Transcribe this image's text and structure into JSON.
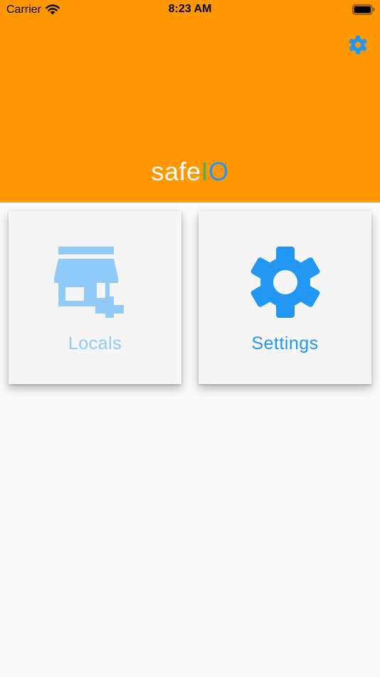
{
  "status_bar": {
    "carrier": "Carrier",
    "time": "8:23 AM",
    "icons": [
      "wifi-icon",
      "battery-icon"
    ]
  },
  "header": {
    "background_color": "#ff9800",
    "settings_icon": "gear-icon",
    "logo": {
      "part1": "safe",
      "part2": "I",
      "part3": "O",
      "colors": {
        "part1": "#ffffff",
        "part2": "#4caf50",
        "part3": "#2196f3"
      }
    }
  },
  "tiles": [
    {
      "label": "Locals",
      "icon": "store-add-icon",
      "color": "#90caf9"
    },
    {
      "label": "Settings",
      "icon": "gear-icon",
      "color": "#2196f3"
    }
  ]
}
